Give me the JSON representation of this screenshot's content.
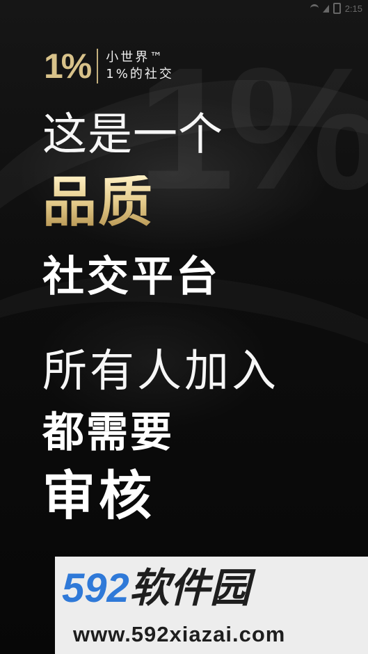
{
  "status": {
    "time": "2:15"
  },
  "brand": {
    "mark": "1%",
    "name": "小世界™",
    "slogan": "1%的社交"
  },
  "headline": {
    "line1": "这是一个",
    "line2": "品质",
    "line3": "社交平台",
    "line4": "所有人加入",
    "line5": "都需要",
    "line6": "审核"
  },
  "watermark": {
    "number": "592",
    "chinese": "软件园",
    "url": "www.592xiazai.com",
    "background_mark": "1%"
  },
  "colors": {
    "gold": "#d8c28a",
    "background": "#0b0b0b",
    "overlay_blue": "#2f79d8",
    "text": "#ffffff"
  },
  "icons": {
    "wifi": "wifi-icon",
    "signal": "signal-icon",
    "battery": "battery-icon"
  }
}
